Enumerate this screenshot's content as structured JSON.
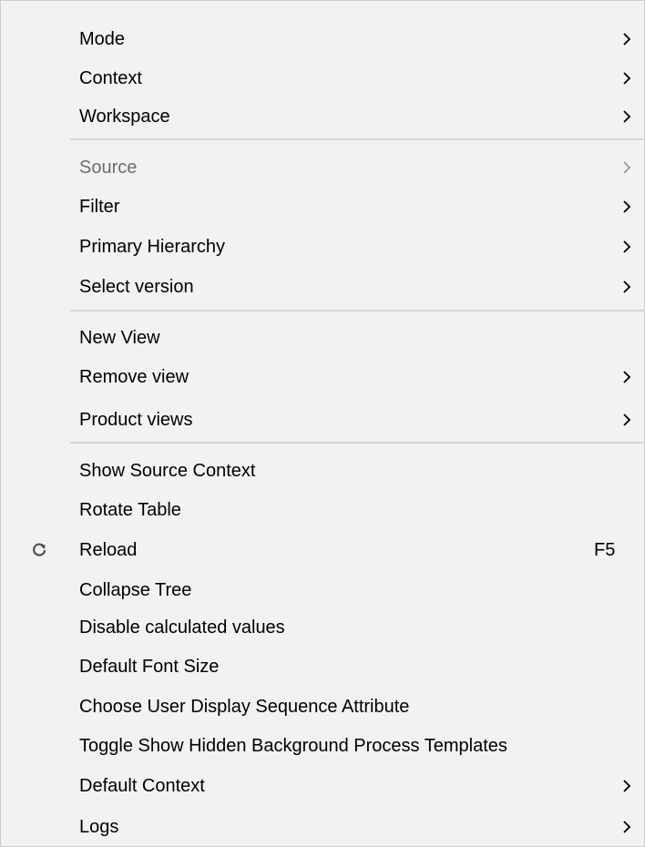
{
  "menu": {
    "items": [
      {
        "label": "Mode",
        "submenu": true
      },
      {
        "label": "Context",
        "submenu": true
      },
      {
        "label": "Workspace",
        "submenu": true
      },
      {
        "label": "Source",
        "submenu": true,
        "disabled": true
      },
      {
        "label": "Filter",
        "submenu": true
      },
      {
        "label": "Primary Hierarchy",
        "submenu": true
      },
      {
        "label": "Select version",
        "submenu": true
      },
      {
        "label": "New View",
        "submenu": false
      },
      {
        "label": "Remove view",
        "submenu": true
      },
      {
        "label": "Product views",
        "submenu": true
      },
      {
        "label": "Show Source Context",
        "submenu": false
      },
      {
        "label": "Rotate Table",
        "submenu": false
      },
      {
        "label": "Reload",
        "submenu": false,
        "shortcut": "F5",
        "icon": "refresh-icon"
      },
      {
        "label": "Collapse Tree",
        "submenu": false
      },
      {
        "label": "Disable calculated values",
        "submenu": false
      },
      {
        "label": "Default Font Size",
        "submenu": false
      },
      {
        "label": "Choose User Display Sequence Attribute",
        "submenu": false
      },
      {
        "label": "Toggle Show Hidden Background Process Templates",
        "submenu": false
      },
      {
        "label": "Default Context",
        "submenu": true
      },
      {
        "label": "Logs",
        "submenu": true
      }
    ]
  },
  "colors": {
    "background": "#f2f2f2",
    "text": "#000000",
    "disabled_text": "#6d6d6d",
    "separator": "#d6d6d6",
    "icon": "#505050"
  }
}
